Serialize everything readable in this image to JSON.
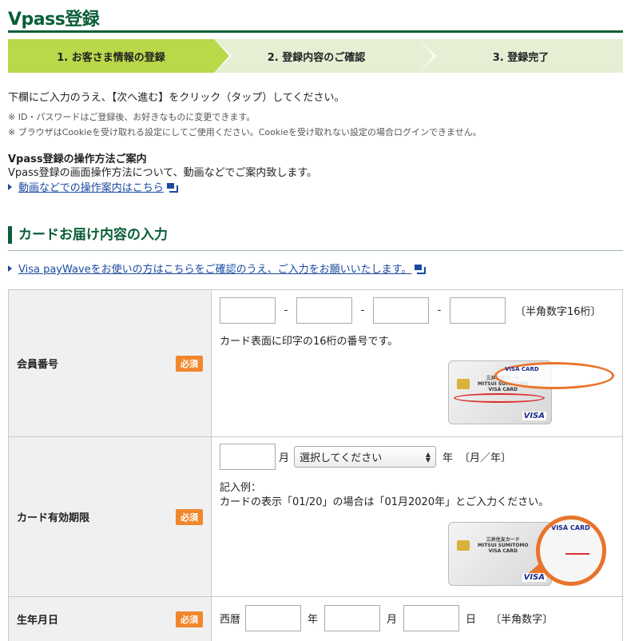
{
  "page": {
    "title": "Vpass登録"
  },
  "steps": [
    {
      "label": "1. お客さま情報の登録"
    },
    {
      "label": "2. 登録内容のご確認"
    },
    {
      "label": "3. 登録完了"
    }
  ],
  "intro": {
    "instruction": "下欄にご入力のうえ、【次へ進む】をクリック（タップ）してください。",
    "note1": "※ ID・パスワードはご登録後、お好きなものに変更できます。",
    "note2": "※ ブラウザはCookieを受け取れる設定にしてご使用ください。Cookieを受け取れない設定の場合ログインできません。"
  },
  "guide": {
    "heading": "Vpass登録の操作方法ご案内",
    "text": "Vpass登録の画面操作方法について、動画などでご案内致します。",
    "link": "動画などでの操作案内はこちら"
  },
  "section": {
    "title": "カードお届け内容の入力",
    "paywave_link": "Visa payWaveをお使いの方はこちらをご確認のうえ、ご入力をお願いいたします。"
  },
  "form": {
    "required_label": "必須",
    "card_number": {
      "label": "会員番号",
      "dash": "-",
      "hint": "〔半角数字16桁〕",
      "description": "カード表面に印字の16桁の番号です。",
      "card_brand": "三井住友カード\nMITSUI SUMITOMO\nVISA CARD",
      "card_logo": "VISA",
      "oval_label": "VISA CARD"
    },
    "expiry": {
      "label": "カード有効期限",
      "month_unit": "月",
      "year_select": "選択してください",
      "year_unit": "年",
      "format": "〔月／年〕",
      "example_heading": "記入例：",
      "example_text": "カードの表示「01/20」の場合は「01月2020年」とご入力ください。",
      "zoom_label": "VISA CARD",
      "card_logo": "VISA"
    },
    "birthdate": {
      "label": "生年月日",
      "era": "西暦",
      "year_unit": "年",
      "month_unit": "月",
      "day_unit": "日",
      "hint": "〔半角数字〕"
    }
  },
  "colors": {
    "brand_green": "#0b5e38",
    "step_active": "#b9d84a",
    "step_inactive": "#e5efd4",
    "required": "#f0872c",
    "link": "#1a4aa0"
  }
}
